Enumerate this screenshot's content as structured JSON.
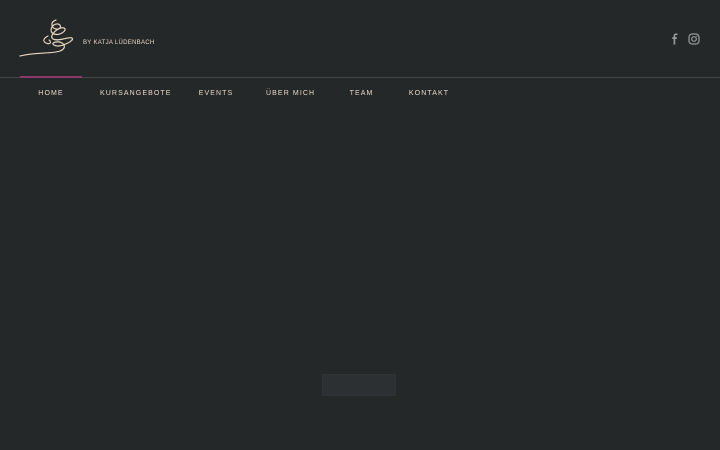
{
  "brand": {
    "logo_name": "logo-mark",
    "tagline": "BY KATJA LÜDENBACH"
  },
  "social": {
    "facebook": "facebook-icon",
    "instagram": "instagram-icon"
  },
  "nav": {
    "items": [
      {
        "label": "HOME",
        "active": true
      },
      {
        "label": "KURSANGEBOTE",
        "active": false
      },
      {
        "label": "EVENTS",
        "active": false
      },
      {
        "label": "ÜBER MICH",
        "active": false
      },
      {
        "label": "TEAM",
        "active": false
      },
      {
        "label": "KONTAKT",
        "active": false
      }
    ]
  },
  "colors": {
    "background": "#252829",
    "accent": "#8a3a6a",
    "text": "#e7d8c6"
  }
}
